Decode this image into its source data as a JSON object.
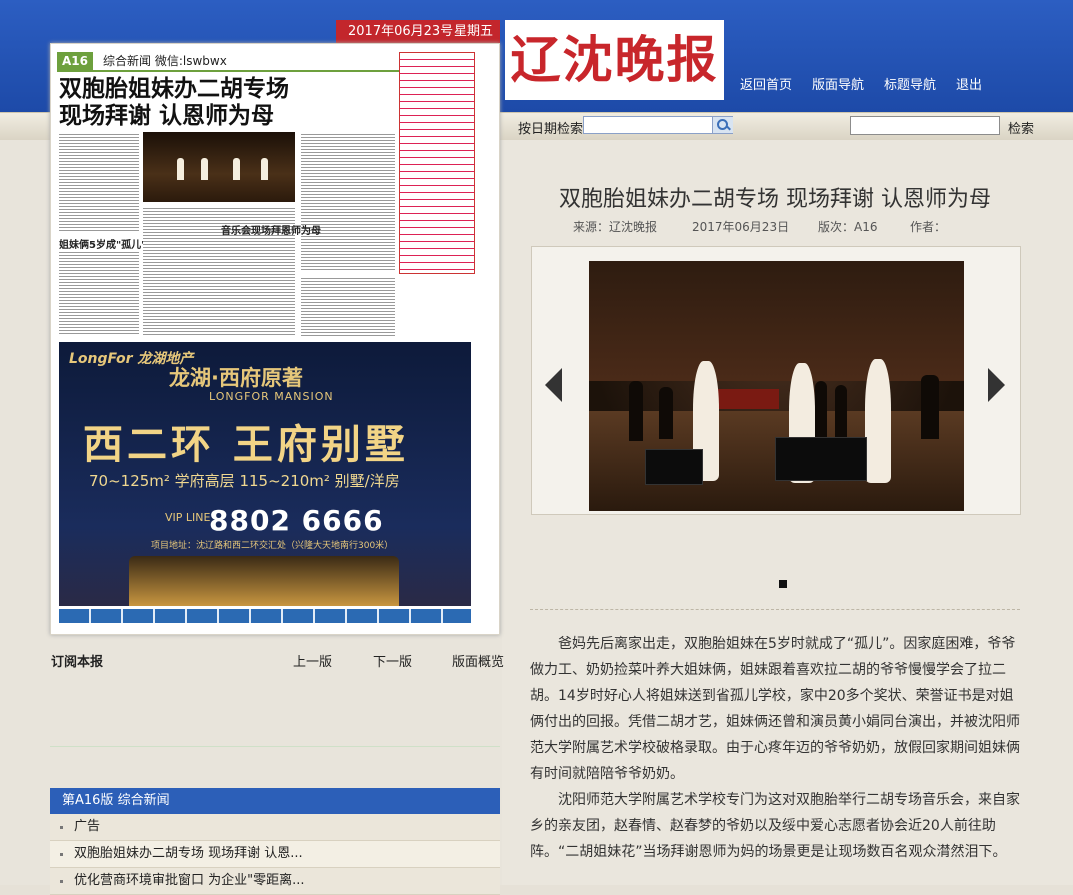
{
  "header": {
    "date": "2017年06月23号",
    "weekday": "星期五",
    "logo_text": "辽沈晚报",
    "nav": [
      "返回首页",
      "版面导航",
      "标题导航",
      "退出"
    ]
  },
  "search": {
    "date_label": "按日期检索",
    "search_label": "检索"
  },
  "paper": {
    "page_no": "A16",
    "section": "综合新闻  微信:lswbwx",
    "headline_1": "双胞胎姐妹办二胡专场",
    "headline_2": "现场拜谢 认恩师为母",
    "subhead_1": "姐妹俩5岁成\"孤儿\"",
    "subhead_2": "音乐会现场拜恩师为母",
    "ad": {
      "brand": "LongFor 龙湖地产",
      "mansion": "龙湖·西府原著",
      "mansion_en": "LONGFOR MANSION",
      "headline": "西二环 王府别墅",
      "areas": "70~125m² 学府高层    115~210m² 别墅/洋房",
      "vip": "VIP LINE",
      "phone": "8802 6666",
      "address": "项目地址：沈辽路和西二环交汇处（兴隆大天地南行300米）"
    }
  },
  "article": {
    "title": "双胞胎姐妹办二胡专场 现场拜谢 认恩师为母",
    "source": "来源：辽沈晚报",
    "date": "2017年06月23日",
    "edition": "版次：A16",
    "author": "作者：",
    "paragraphs": [
      "爸妈先后离家出走，双胞胎姐妹在5岁时就成了“孤儿”。因家庭困难，爷爷做力工、奶奶捡菜叶养大姐妹俩，姐妹跟着喜欢拉二胡的爷爷慢慢学会了拉二胡。14岁时好心人将姐妹送到省孤儿学校，家中20多个奖状、荣誉证书是对姐俩付出的回报。凭借二胡才艺，姐妹俩还曾和演员黄小娟同台演出，并被沈阳师范大学附属艺术学校破格录取。由于心疼年迈的爷爷奶奶，放假回家期间姐妹俩有时间就陪陪爷爷奶奶。",
      "沈阳师范大学附属艺术学校专门为这对双胞胎举行二胡专场音乐会，来自家乡的亲友团，赵春情、赵春梦的爷奶以及绥中爱心志愿者协会近20人前往助阵。“二胡姐妹花”当场拜谢恩师为妈的场景更是让现场数百名观众潸然泪下。"
    ]
  },
  "left_links": {
    "subscribe": "订阅本报",
    "prev": "上一版",
    "next": "下一版",
    "overview": "版面概览"
  },
  "section_list": {
    "title": "第A16版 综合新闻",
    "items": [
      "广告",
      "双胞胎姐妹办二胡专场 现场拜谢 认恩...",
      "优化营商环境审批窗口 为企业\"零距离..."
    ]
  }
}
